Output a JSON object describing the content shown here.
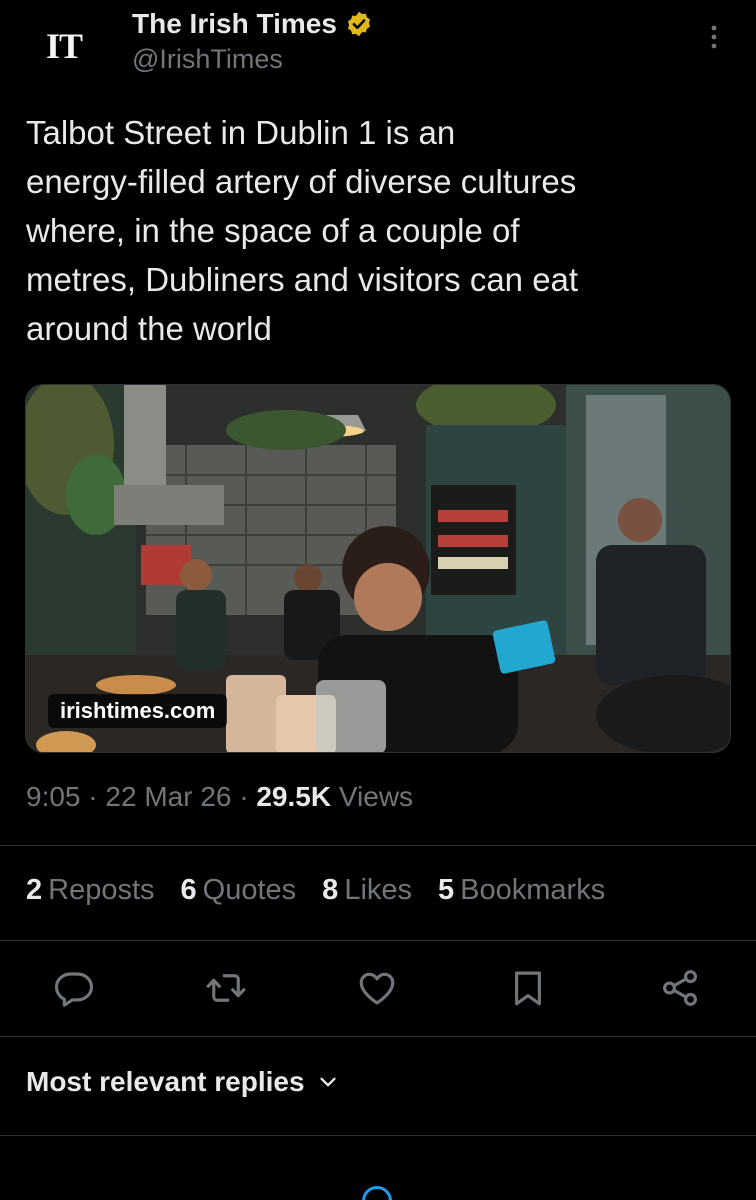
{
  "account": {
    "avatar_text": "IT",
    "name": "The Irish Times",
    "handle": "@IrishTimes",
    "verified_badge": "gold-verified-icon"
  },
  "tweet": {
    "text": "Talbot Street in Dublin 1 is an\nenergy-filled artery of diverse cultures\nwhere, in the space of a couple of\nmetres, Dubliners and visitors can eat\naround the world",
    "media": {
      "link_domain": "irishtimes.com"
    }
  },
  "meta": {
    "time": "9:05",
    "sep1": " · ",
    "date": "22 Mar 26",
    "sep2": " · ",
    "views_count": "29.5K",
    "views_label": " Views"
  },
  "stats": [
    {
      "count": "2",
      "label": "Reposts"
    },
    {
      "count": "6",
      "label": "Quotes"
    },
    {
      "count": "8",
      "label": "Likes"
    },
    {
      "count": "5",
      "label": "Bookmarks"
    }
  ],
  "actions": [
    "reply-icon",
    "repost-icon",
    "like-icon",
    "bookmark-icon",
    "share-icon"
  ],
  "replies": {
    "sort_label": "Most relevant replies"
  },
  "colors": {
    "background": "#000000",
    "text": "#e7e9ea",
    "secondary": "#71767b",
    "divider": "#2f3336",
    "verified_gold": "#e2b719",
    "accent": "#1d9bf0"
  }
}
